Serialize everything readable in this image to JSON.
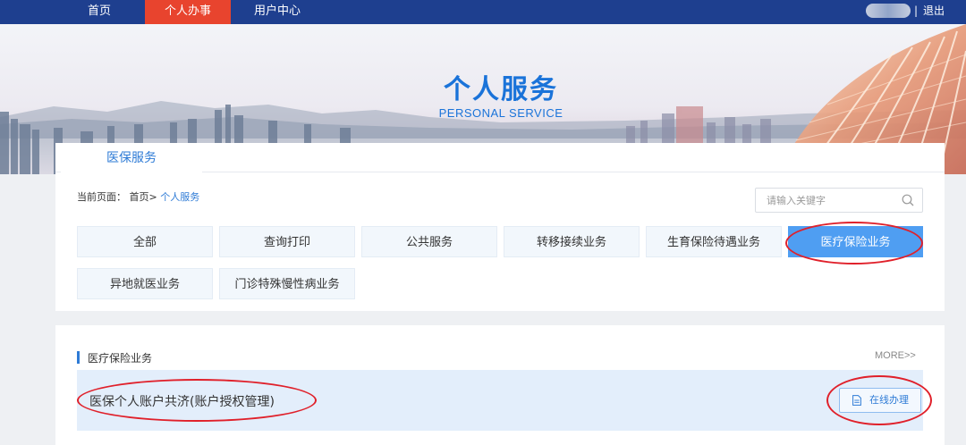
{
  "topnav": {
    "items": [
      {
        "label": "首页",
        "active": false
      },
      {
        "label": "个人办事",
        "active": true
      },
      {
        "label": "用户中心",
        "active": false
      }
    ],
    "logout": "退出"
  },
  "banner": {
    "title": "个人服务",
    "subtitle": "PERSONAL SERVICE"
  },
  "tabs": {
    "active_label": "医保服务"
  },
  "breadcrumb": {
    "prefix": "当前页面：",
    "home": "首页>",
    "current": "个人服务"
  },
  "search": {
    "placeholder": "请输入关键字",
    "value": ""
  },
  "categories": [
    {
      "label": "全部",
      "active": false
    },
    {
      "label": "查询打印",
      "active": false
    },
    {
      "label": "公共服务",
      "active": false
    },
    {
      "label": "转移接续业务",
      "active": false
    },
    {
      "label": "生育保险待遇业务",
      "active": false
    },
    {
      "label": "医疗保险业务",
      "active": true
    },
    {
      "label": "异地就医业务",
      "active": false
    },
    {
      "label": "门诊特殊慢性病业务",
      "active": false
    }
  ],
  "section": {
    "title": "医疗保险业务",
    "more": "MORE>>",
    "items": [
      {
        "name": "医保个人账户共济(账户授权管理)",
        "action": "在线办理"
      }
    ]
  },
  "colors": {
    "nav_bg": "#1e3f8f",
    "nav_active": "#e8442e",
    "accent_blue": "#2e7bd6",
    "category_active": "#4f9ef2",
    "annotation_red": "#e0202a"
  }
}
